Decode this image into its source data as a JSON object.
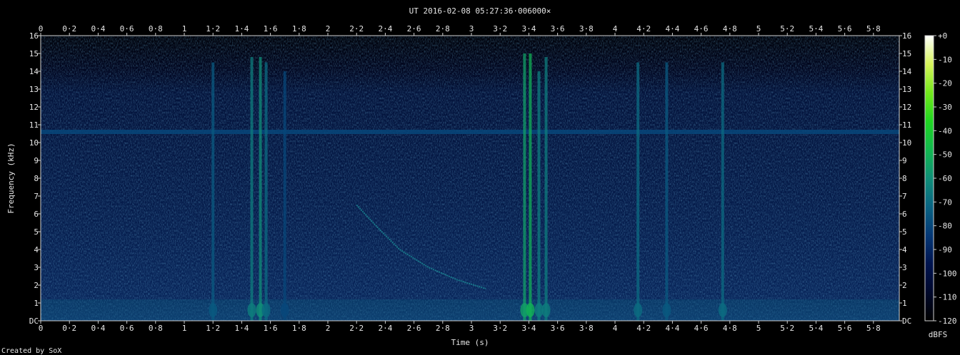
{
  "chart_data": {
    "type": "heatmap",
    "title": "UT 2016-02-08 05:27:36·006000×",
    "xlabel": "Time (s)",
    "ylabel": "Frequency (kHz)",
    "xlim": [
      0,
      5.98
    ],
    "ylim": [
      0,
      16
    ],
    "x_ticks": [
      "0",
      "0·2",
      "0·4",
      "0·6",
      "0·8",
      "1",
      "1·2",
      "1·4",
      "1·6",
      "1·8",
      "2",
      "2·2",
      "2·4",
      "2·6",
      "2·8",
      "3",
      "3·2",
      "3·4",
      "3·6",
      "3·8",
      "4",
      "4·2",
      "4·4",
      "4·6",
      "4·8",
      "5",
      "5·2",
      "5·4",
      "5·6",
      "5·8"
    ],
    "x_tick_values": [
      0,
      0.2,
      0.4,
      0.6,
      0.8,
      1,
      1.2,
      1.4,
      1.6,
      1.8,
      2,
      2.2,
      2.4,
      2.6,
      2.8,
      3,
      3.2,
      3.4,
      3.6,
      3.8,
      4,
      4.2,
      4.4,
      4.6,
      4.8,
      5,
      5.2,
      5.4,
      5.6,
      5.8
    ],
    "y_ticks": [
      "DC",
      "1",
      "2",
      "3",
      "4",
      "5",
      "6",
      "7",
      "8",
      "9",
      "10",
      "11",
      "12",
      "13",
      "14",
      "15",
      "16"
    ],
    "y_tick_values": [
      0,
      1,
      2,
      3,
      4,
      5,
      6,
      7,
      8,
      9,
      10,
      11,
      12,
      13,
      14,
      15,
      16
    ],
    "colorbar": {
      "label": "dBFS",
      "ticks": [
        "+0",
        "-10",
        "-20",
        "-30",
        "-40",
        "-50",
        "-60",
        "-70",
        "-80",
        "-90",
        "-100",
        "-110",
        "-120"
      ],
      "tick_values": [
        0,
        -10,
        -20,
        -30,
        -40,
        -50,
        -60,
        -70,
        -80,
        -90,
        -100,
        -110,
        -120
      ],
      "range": [
        -120,
        0
      ]
    },
    "features": {
      "background_level_dbfs": -100,
      "hum_line": {
        "frequency_khz": 10.6,
        "level_dbfs": -80
      },
      "broadband_events": [
        {
          "time_s": 1.2,
          "max_freq_khz": 14.5,
          "level_dbfs": -75
        },
        {
          "time_s": 1.47,
          "max_freq_khz": 14.8,
          "level_dbfs": -65
        },
        {
          "time_s": 1.53,
          "max_freq_khz": 14.8,
          "level_dbfs": -60
        },
        {
          "time_s": 1.57,
          "max_freq_khz": 14.5,
          "level_dbfs": -70
        },
        {
          "time_s": 1.7,
          "max_freq_khz": 14.0,
          "level_dbfs": -80
        },
        {
          "time_s": 3.37,
          "max_freq_khz": 15.0,
          "level_dbfs": -55
        },
        {
          "time_s": 3.41,
          "max_freq_khz": 15.0,
          "level_dbfs": -50
        },
        {
          "time_s": 3.47,
          "max_freq_khz": 14.0,
          "level_dbfs": -65
        },
        {
          "time_s": 3.52,
          "max_freq_khz": 14.8,
          "level_dbfs": -65
        },
        {
          "time_s": 4.16,
          "max_freq_khz": 14.5,
          "level_dbfs": -70
        },
        {
          "time_s": 4.36,
          "max_freq_khz": 14.5,
          "level_dbfs": -75
        },
        {
          "time_s": 4.75,
          "max_freq_khz": 14.5,
          "level_dbfs": -70
        }
      ],
      "chirp": [
        {
          "time_s": 2.2,
          "freq_khz": 6.5
        },
        {
          "time_s": 2.35,
          "freq_khz": 5.2
        },
        {
          "time_s": 2.5,
          "freq_khz": 4.0
        },
        {
          "time_s": 2.7,
          "freq_khz": 3.0
        },
        {
          "time_s": 2.9,
          "freq_khz": 2.3
        },
        {
          "time_s": 3.1,
          "freq_khz": 1.8
        }
      ]
    }
  },
  "footer": {
    "credit": "Created by SoX"
  }
}
